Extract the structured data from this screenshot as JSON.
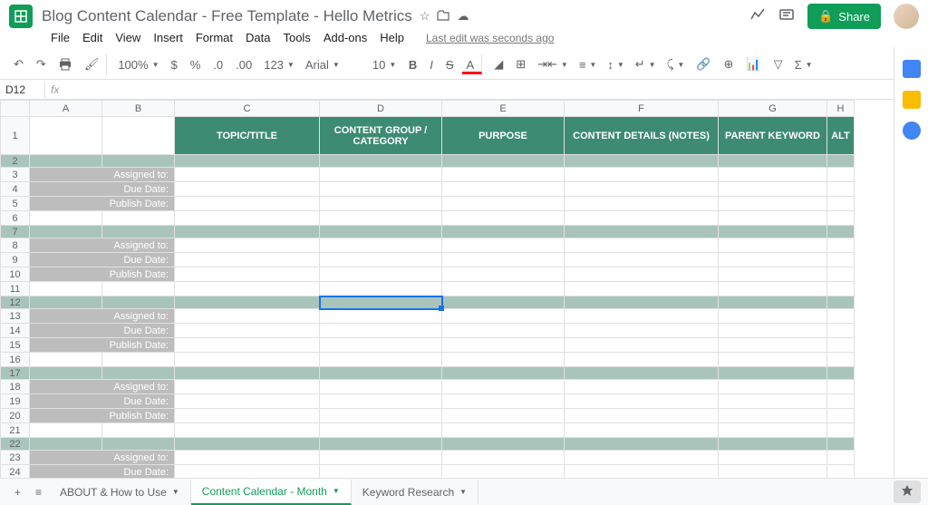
{
  "doc_title": "Blog Content Calendar - Free Template - Hello Metrics",
  "menus": [
    "File",
    "Edit",
    "View",
    "Insert",
    "Format",
    "Data",
    "Tools",
    "Add-ons",
    "Help"
  ],
  "last_edit": "Last edit was seconds ago",
  "share_label": "Share",
  "toolbar": {
    "zoom": "100%",
    "font": "Arial",
    "size": "10"
  },
  "namebox": "D12",
  "col_letters": [
    "A",
    "B",
    "C",
    "D",
    "E",
    "F",
    "G",
    "H"
  ],
  "headers": {
    "C": "TOPIC/TITLE",
    "D": "CONTENT GROUP / CATEGORY",
    "E": "PURPOSE",
    "F": "CONTENT DETAILS (NOTES)",
    "G": "PARENT KEYWORD",
    "H": "ALT"
  },
  "row_labels": {
    "assigned": "Assigned to:",
    "due": "Due Date:",
    "publish": "Publish Date:"
  },
  "sheets": {
    "about": "ABOUT & How to Use",
    "calendar": "Content Calendar - Month",
    "keyword": "Keyword Research"
  }
}
